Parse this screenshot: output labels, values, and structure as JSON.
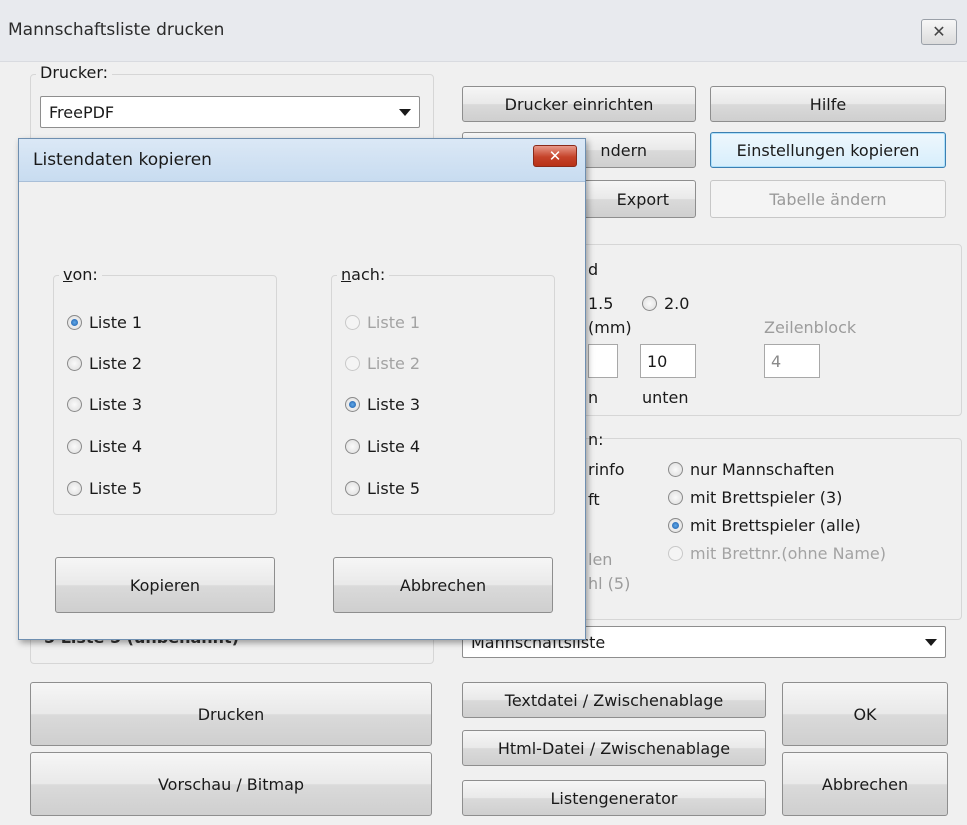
{
  "window": {
    "title": "Mannschaftsliste drucken",
    "close_glyph": "✕"
  },
  "printer": {
    "legend": "Drucker:",
    "selected": "FreePDF"
  },
  "top_buttons": {
    "setup": "Drucker einrichten",
    "help": "Hilfe",
    "change_partial": "ndern",
    "copy_settings": "Einstellungen kopieren",
    "export": "Export",
    "table_change": "Tabelle ändern"
  },
  "layout_group": {
    "partial_d": "d",
    "spacing_15": "1.5",
    "spacing_20": "2.0",
    "mm_label": "(mm)",
    "zeilenblock_label": "Zeilenblock",
    "bottom_value": "10",
    "zeilenblock_value": "4",
    "n_label": "n",
    "unten_label": "unten"
  },
  "content_group": {
    "partial_colon": "n:",
    "partial_info": "rinfo",
    "partial_ft": "ft",
    "partial_len": "len",
    "partial_hl": "hl (5)",
    "opt_only_teams": "nur Mannschaften",
    "opt_board_3": "mit Brettspieler (3)",
    "opt_board_all": "mit Brettspieler (alle)",
    "opt_board_no": "mit Brettnr.(ohne Name)"
  },
  "list_select": {
    "selected": "Mannschaftsliste"
  },
  "hidden_list_label": "5 Liste 5  (unbenannt)",
  "bottom_buttons": {
    "print": "Drucken",
    "preview": "Vorschau / Bitmap",
    "text_file": "Textdatei / Zwischenablage",
    "html_file": "Html-Datei / Zwischenablage",
    "generator": "Listengenerator",
    "ok": "OK",
    "cancel": "Abbrechen"
  },
  "dialog": {
    "title": "Listendaten kopieren",
    "close_glyph": "✕",
    "from_legend_u": "v",
    "from_legend_rest": "on:",
    "to_legend_u": "n",
    "to_legend_rest": "ach:",
    "from_items": [
      "Liste 1",
      "Liste 2",
      "Liste 3",
      "Liste 4",
      "Liste 5"
    ],
    "to_items": [
      "Liste 1",
      "Liste 2",
      "Liste 3",
      "Liste 4",
      "Liste 5"
    ],
    "copy_button": "Kopieren",
    "cancel_button": "Abbrechen"
  }
}
